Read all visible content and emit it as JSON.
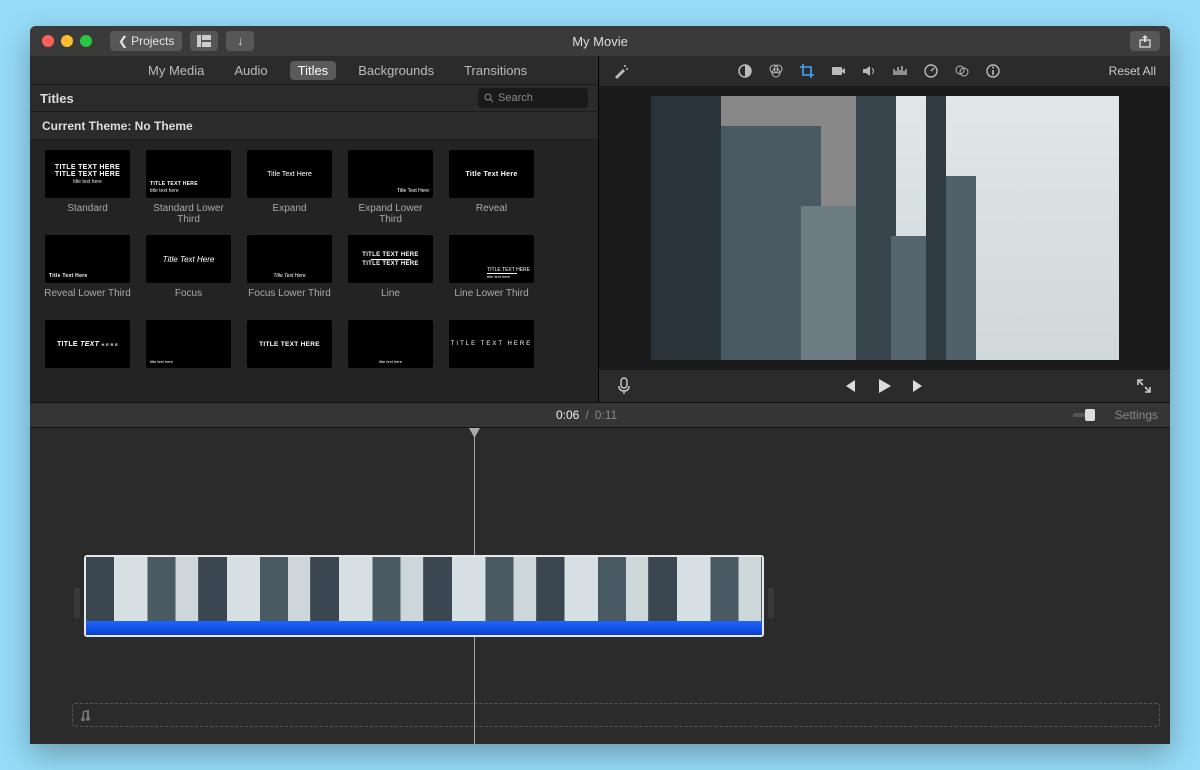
{
  "titlebar": {
    "projects_label": "Projects",
    "app_title": "My Movie"
  },
  "tabs": {
    "my_media": "My Media",
    "audio": "Audio",
    "titles": "Titles",
    "backgrounds": "Backgrounds",
    "transitions": "Transitions"
  },
  "section": {
    "title": "Titles",
    "search_placeholder": "Search"
  },
  "theme_row": "Current Theme: No Theme",
  "titles_grid": [
    {
      "name": "Standard",
      "style": "std"
    },
    {
      "name": "Standard Lower Third",
      "style": "std-lt"
    },
    {
      "name": "Expand",
      "style": "expand"
    },
    {
      "name": "Expand Lower Third",
      "style": "expand-lt"
    },
    {
      "name": "Reveal",
      "style": "reveal"
    },
    {
      "name": "Reveal Lower Third",
      "style": "reveal-lt"
    },
    {
      "name": "Focus",
      "style": "focus"
    },
    {
      "name": "Focus Lower Third",
      "style": "focus-lt"
    },
    {
      "name": "Line",
      "style": "line"
    },
    {
      "name": "Line Lower Third",
      "style": "line-lt"
    },
    {
      "name": "",
      "style": "prism"
    },
    {
      "name": "",
      "style": "prism-lt"
    },
    {
      "name": "",
      "style": "gravity"
    },
    {
      "name": "",
      "style": "gravity-lt"
    },
    {
      "name": "",
      "style": "pop"
    }
  ],
  "thumb_text": {
    "main": "TITLE TEXT HERE",
    "alt": "Title Text Here"
  },
  "reset_label": "Reset All",
  "playback": {
    "current": "0:06",
    "total": "0:11"
  },
  "settings_label": "Settings"
}
